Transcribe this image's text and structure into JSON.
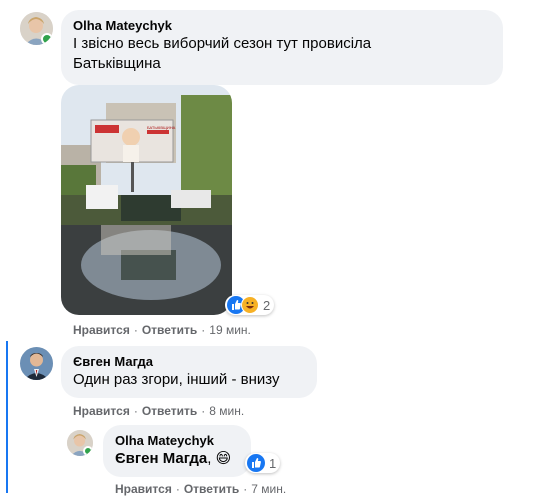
{
  "comments": [
    {
      "author": "Olha Mateychyk",
      "text": "І звісно весь виборчий сезон тут провисіла Батьківщина",
      "actions": {
        "like": "Нравится",
        "reply": "Ответить",
        "time": "19 мин."
      },
      "reactions": {
        "icons": [
          "like-icon",
          "haha-icon"
        ],
        "count": "2"
      },
      "online": true
    },
    {
      "author": "Євген Магда",
      "text": "Один раз згори, інший - внизу",
      "actions": {
        "like": "Нравится",
        "reply": "Ответить",
        "time": "8 мин."
      }
    },
    {
      "author": "Olha Mateychyk",
      "mention": "Євген Магда",
      "suffix": ",",
      "emoji": "😄",
      "actions": {
        "like": "Нравится",
        "reply": "Ответить",
        "time": "7 мин."
      },
      "reactions": {
        "icons": [
          "like-icon"
        ],
        "count": "1"
      },
      "online": true
    }
  ],
  "photo": {
    "billboard_text": "БАТЬКІВЩИНА"
  },
  "colors": {
    "bubble": "#f0f2f5",
    "accent": "#1877f2",
    "meta": "#65676b",
    "online": "#31a24c"
  }
}
